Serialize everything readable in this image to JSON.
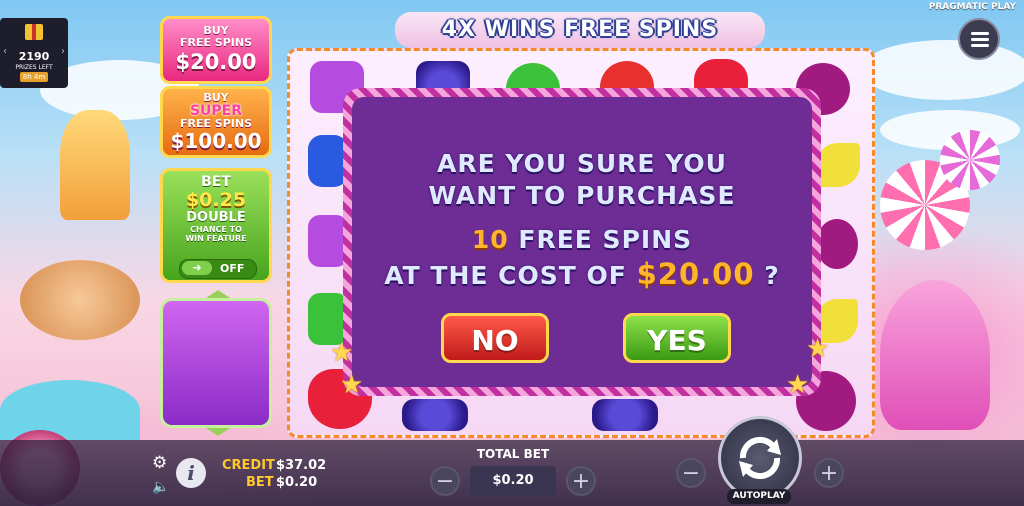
{
  "header": {
    "title": "4X WINS FREE SPINS",
    "provider": "PRAGMATIC PLAY"
  },
  "prize_drop": {
    "count": "2190",
    "label": "PRIZES LEFT",
    "timer": "8h 4m"
  },
  "buy_free_spins": {
    "line1": "BUY",
    "line2": "FREE SPINS",
    "price": "$20.00"
  },
  "buy_super_free_spins": {
    "line1": "BUY",
    "line2": "SUPER",
    "line3": "FREE SPINS",
    "price": "$100.00"
  },
  "ante_bet": {
    "bet_label": "BET",
    "bet_value": "$0.25",
    "double_label": "DOUBLE",
    "chance_line1": "CHANCE TO",
    "chance_line2": "WIN FEATURE",
    "toggle_state": "OFF"
  },
  "dialog": {
    "line1": "ARE YOU SURE YOU",
    "line2": "WANT TO PURCHASE",
    "spins_count": "10",
    "spins_text": "FREE SPINS",
    "cost_text": "AT THE COST OF",
    "cost_value": "$20.00",
    "question_mark": "?",
    "no_label": "NO",
    "yes_label": "YES"
  },
  "bottom_bar": {
    "credit_label": "CREDIT",
    "credit_value": "$37.02",
    "bet_label": "BET",
    "bet_value": "$0.20",
    "total_bet_label": "TOTAL BET",
    "total_bet_value": "$0.20",
    "minus_symbol": "−",
    "plus_symbol": "+",
    "autoplay_label": "AUTOPLAY",
    "info_symbol": "i"
  },
  "symbols": [
    "purple-candy",
    "grapes",
    "green-candy",
    "apple",
    "red-heart",
    "plum",
    "blue-candy",
    "banana",
    "purple-candy",
    "plum",
    "green-candy",
    "banana",
    "red-heart",
    "grapes",
    "grapes",
    "plum"
  ],
  "colors": {
    "dialog_bg": "#6e2d95",
    "highlight": "#ffb52b",
    "no_button": "#c01a1a",
    "yes_button": "#3a9a12"
  }
}
